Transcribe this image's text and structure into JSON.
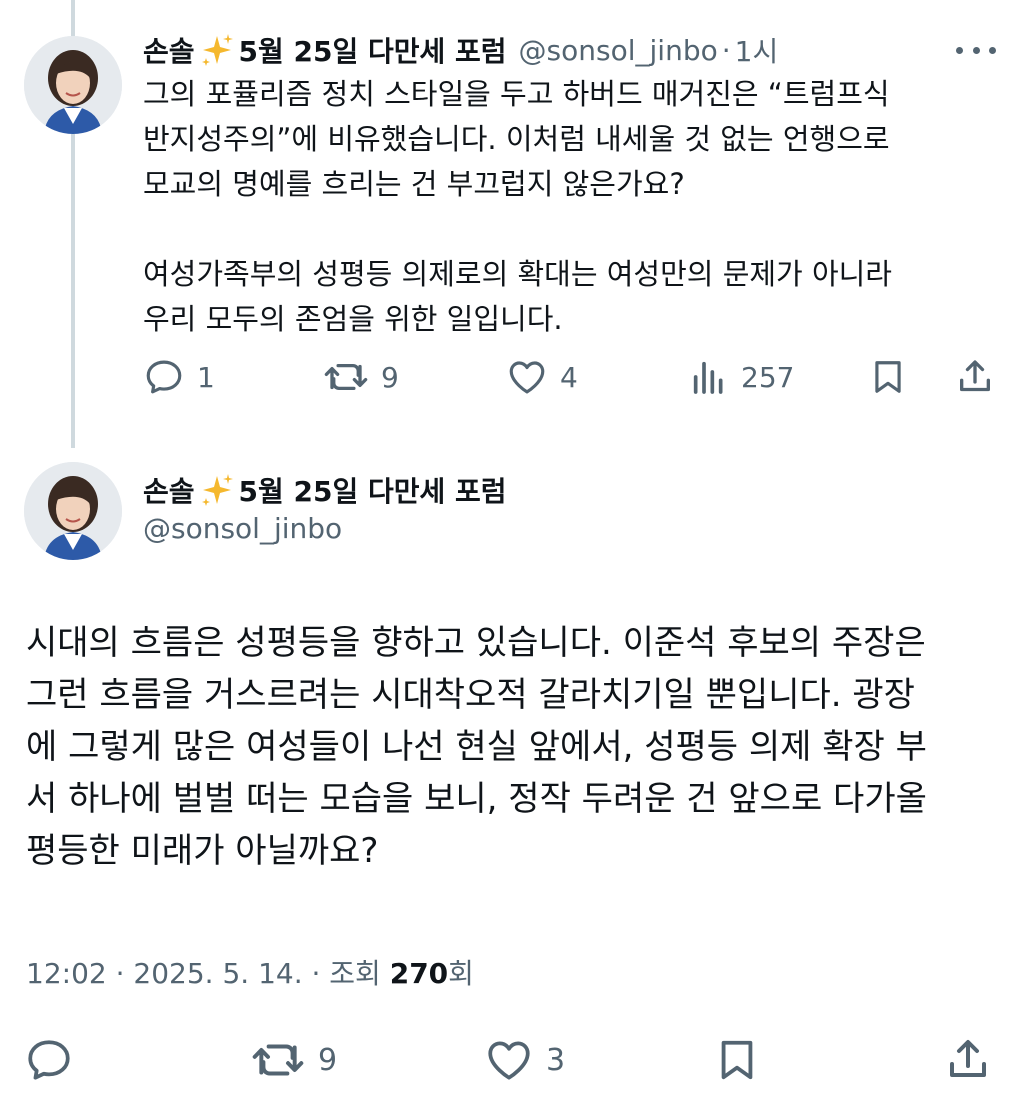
{
  "reply": {
    "display_name": "손솔",
    "name_suffix": "5월 25일 다만세 포럼",
    "handle": "@sonsol_jinbo",
    "separator": "·",
    "time": "1시",
    "paragraph1": [
      "그의 포퓰리즘 정치 스타일을 두고 하버드 매거진은 “트럼프식",
      "반지성주의”에 비유했습니다. 이처럼 내세울 것 없는 언행으로",
      "모교의 명예를 흐리는 건 부끄럽지 않은가요?"
    ],
    "paragraph2": [
      "여성가족부의 성평등 의제로의 확대는 여성만의 문제가 아니라",
      "우리 모두의 존엄을 위한 일입니다."
    ],
    "stats": {
      "replies": "1",
      "reposts": "9",
      "likes": "4",
      "views": "257"
    }
  },
  "main": {
    "display_name": "손솔",
    "name_suffix": "5월 25일 다만세 포럼",
    "handle": "@sonsol_jinbo",
    "body": [
      "시대의 흐름은 성평등을 향하고 있습니다. 이준석 후보의 주장은",
      "그런 흐름을 거스르려는 시대착오적 갈라치기일 뿐입니다. 광장",
      "에 그렇게 많은 여성들이 나선 현실 앞에서, 성평등 의제 확장 부",
      "서 하나에 벌벌 떠는 모습을 보니, 정작 두려운 건 앞으로 다가올",
      "평등한 미래가 아닐까요?"
    ],
    "meta_prefix": "12:02 · 2025. 5. 14. · 조회 ",
    "views": "270",
    "views_suffix": "회",
    "stats": {
      "reposts": "9",
      "likes": "3"
    }
  },
  "icons": {
    "reply": "reply-icon",
    "repost": "repost-icon",
    "like": "heart-icon",
    "views": "views-chart-icon",
    "bookmark": "bookmark-icon",
    "share": "share-icon",
    "more": "more-dots-icon",
    "sparkle": "sparkles-emoji"
  },
  "colors": {
    "text": "#0f1419",
    "secondary": "#536471",
    "thread_line": "#cfd9de",
    "sparkle": "#f5b82e"
  }
}
